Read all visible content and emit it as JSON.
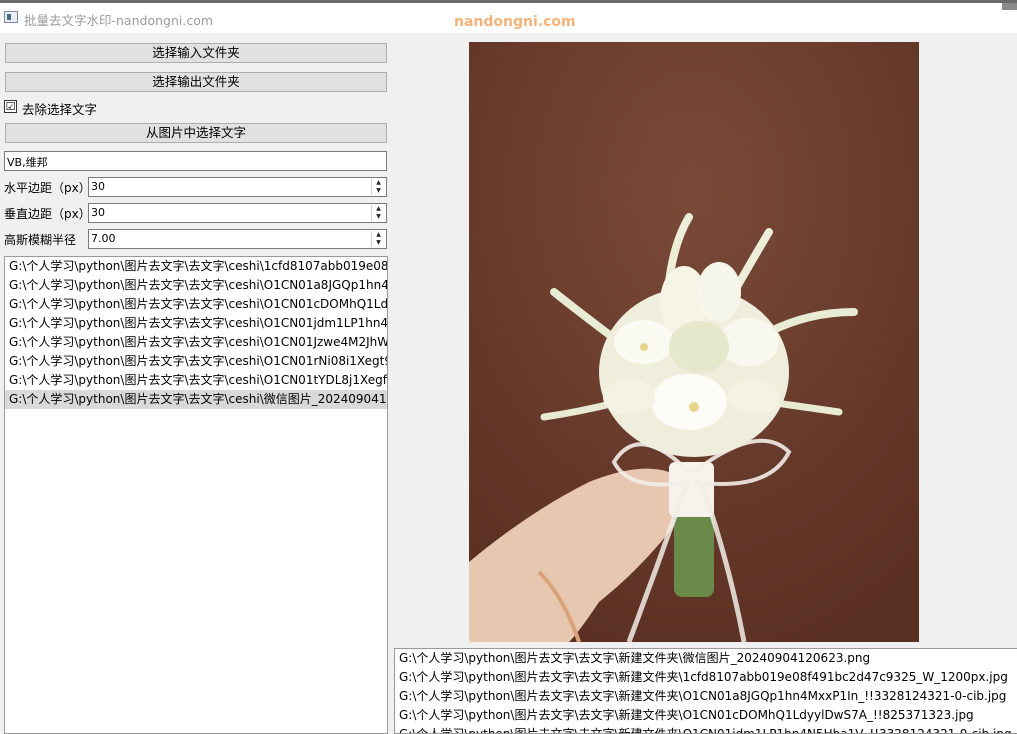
{
  "window": {
    "title": "批量去文字水印-nandongni.com",
    "watermark": "nandongni.com"
  },
  "controls": {
    "select_input_label": "选择输入文件夹",
    "select_output_label": "选择输出文件夹",
    "remove_text_checkbox": {
      "label": "去除选择文字",
      "checked": true,
      "mark": "☑"
    },
    "pick_text_label": "从图片中选择文字",
    "text_value": "VB,维邦",
    "spinners": [
      {
        "label": "水平边距（px）",
        "value": "30"
      },
      {
        "label": "垂直边距（px）",
        "value": "30"
      },
      {
        "label": "高斯模糊半径",
        "value": "7.00"
      }
    ]
  },
  "input_files": [
    "G:\\个人学习\\python\\图片去文字\\去文字\\ceshi\\1cfd8107abb019e08f",
    "G:\\个人学习\\python\\图片去文字\\去文字\\ceshi\\O1CN01a8JGQp1hn4",
    "G:\\个人学习\\python\\图片去文字\\去文字\\ceshi\\O1CN01cDOMhQ1Ld",
    "G:\\个人学习\\python\\图片去文字\\去文字\\ceshi\\O1CN01jdm1LP1hn4l",
    "G:\\个人学习\\python\\图片去文字\\去文字\\ceshi\\O1CN01Jzwe4M2JhW",
    "G:\\个人学习\\python\\图片去文字\\去文字\\ceshi\\O1CN01rNi08i1Xegt9",
    "G:\\个人学习\\python\\图片去文字\\去文字\\ceshi\\O1CN01tYDL8j1Xegfl",
    "G:\\个人学习\\python\\图片去文字\\去文字\\ceshi\\微信图片_2024090412"
  ],
  "selected_input_index": 7,
  "output_files": [
    "G:\\个人学习\\python\\图片去文字\\去文字\\新建文件夹\\微信图片_20240904120623.png",
    "G:\\个人学习\\python\\图片去文字\\去文字\\新建文件夹\\1cfd8107abb019e08f491bc2d47c9325_W_1200px.jpg",
    "G:\\个人学习\\python\\图片去文字\\去文字\\新建文件夹\\O1CN01a8JGQp1hn4MxxP1In_!!3328124321-0-cib.jpg",
    "G:\\个人学习\\python\\图片去文字\\去文字\\新建文件夹\\O1CN01cDOMhQ1LdyylDwS7A_!!825371323.jpg",
    "G:\\个人学习\\python\\图片去文字\\去文字\\新建文件夹\\O1CN01jdm1LP1hn4N5Hba1V_!!3328124321-0-cib.jpg"
  ],
  "colors": {
    "photo_background": "#6a3c2c",
    "watermark": "#f3b27a",
    "selection": "#d9d9d9"
  }
}
